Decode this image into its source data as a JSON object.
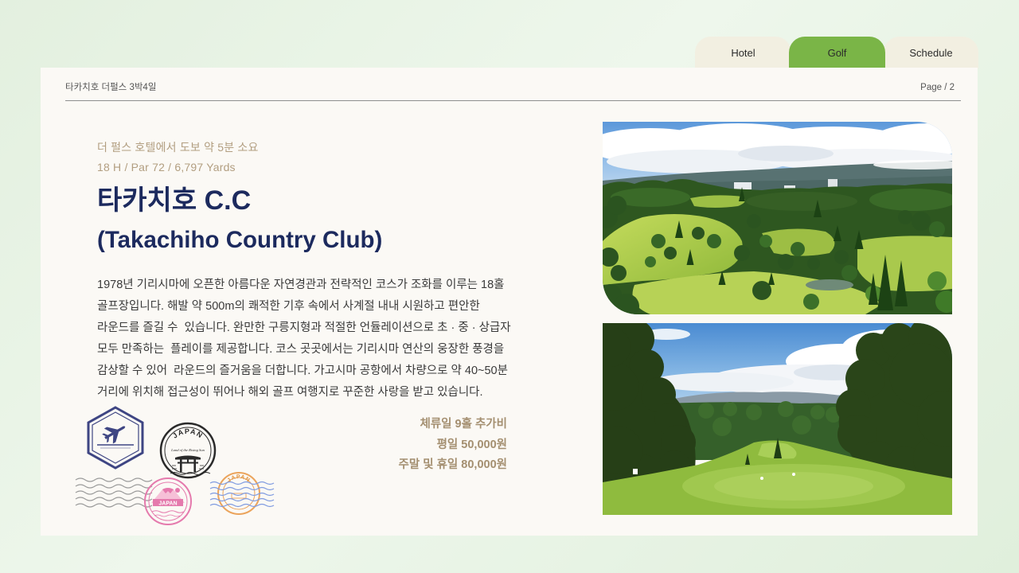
{
  "tabs": [
    {
      "label": "Hotel",
      "active": false
    },
    {
      "label": "Golf",
      "active": true
    },
    {
      "label": "Schedule",
      "active": false
    }
  ],
  "header": {
    "title": "타카치호 더펄스 3박4일",
    "page": "Page / 2"
  },
  "course": {
    "access": "더 펄스 호텔에서 도보 약 5분 소요",
    "specs": "18 H / Par 72 / 6,797 Yards",
    "name_ko": "타카치호 C.C",
    "name_en": "(Takachiho Country Club)",
    "description_lines": [
      "1978년 기리시마에 오픈한 아름다운 자연경관과 전략적인 코스가 조화를 이루는 18홀",
      "골프장입니다. 해발 약 500m의 쾌적한 기후 속에서 사계절 내내 시원하고 편안한",
      "라운드를 즐길 수  있습니다. 완만한 구릉지형과 적절한 언듈레이션으로 초 · 중 · 상급자",
      "모두 만족하는  플레이를 제공합니다. 코스 곳곳에서는 기리시마 연산의 웅장한 풍경을",
      "감상할 수 있어  라운드의 즐거움을 더합니다. 가고시마 공항에서 차량으로 약 40~50분",
      "거리에 위치해 접근성이 뛰어나 해외 골프 여행지로 꾸준한 사랑을 받고 있습니다."
    ],
    "fees": {
      "title": "체류일 9홀 추가비",
      "weekday": "평일 50,000원",
      "weekend": "주말 및 휴일 80,000원"
    }
  },
  "stamps": [
    {
      "icon": "plane-hexagon-stamp"
    },
    {
      "icon": "torii-gate-stamp",
      "text": "JAPAN",
      "subtext": "Land of the Rising Sun"
    },
    {
      "icon": "mount-fuji-stamp",
      "text": "JAPAN"
    },
    {
      "icon": "round-postmark-stamp",
      "text": "JAPAN"
    },
    {
      "icon": "wavy-postmark-lines"
    }
  ],
  "colors": {
    "accent": "#7ab547",
    "tab_bg": "#f2efe1",
    "card_bg": "#fbf9f5",
    "heading": "#1c2a5e",
    "muted": "#b29e80",
    "body_text": "#3a3a3a",
    "fee_text": "#a48f70"
  }
}
